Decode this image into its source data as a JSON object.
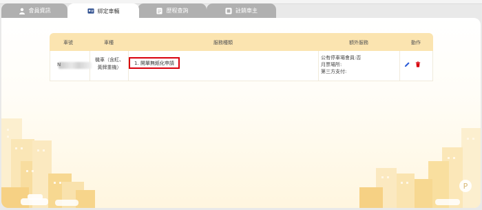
{
  "tabs": [
    {
      "label": "會員資訊",
      "icon": "user-icon",
      "active": false
    },
    {
      "label": "綁定車輛",
      "icon": "vehicle-id-card-icon",
      "active": true
    },
    {
      "label": "歷程查詢",
      "icon": "document-icon",
      "active": false
    },
    {
      "label": "註銷車主",
      "icon": "deregister-icon",
      "active": false
    }
  ],
  "table": {
    "headers": {
      "plate": "車號",
      "type": "車種",
      "service": "服務種類",
      "extra": "額外服務",
      "actions": "動作"
    },
    "rows": [
      {
        "plate_prefix": "N",
        "type_line1": "機車（含紅、",
        "type_line2": "黃牌重機）",
        "service": "1. 開單無紙化申請",
        "extra_line1": "公有停車場會員:否",
        "extra_line2": "月票場所:",
        "extra_line3": "第三方支付:"
      }
    ]
  },
  "colors": {
    "accent": "#fbe4b0",
    "tab_inactive": "#b0b0b0",
    "highlight": "#d8000c",
    "edit": "#2a5bd7",
    "delete": "#d8000c"
  }
}
